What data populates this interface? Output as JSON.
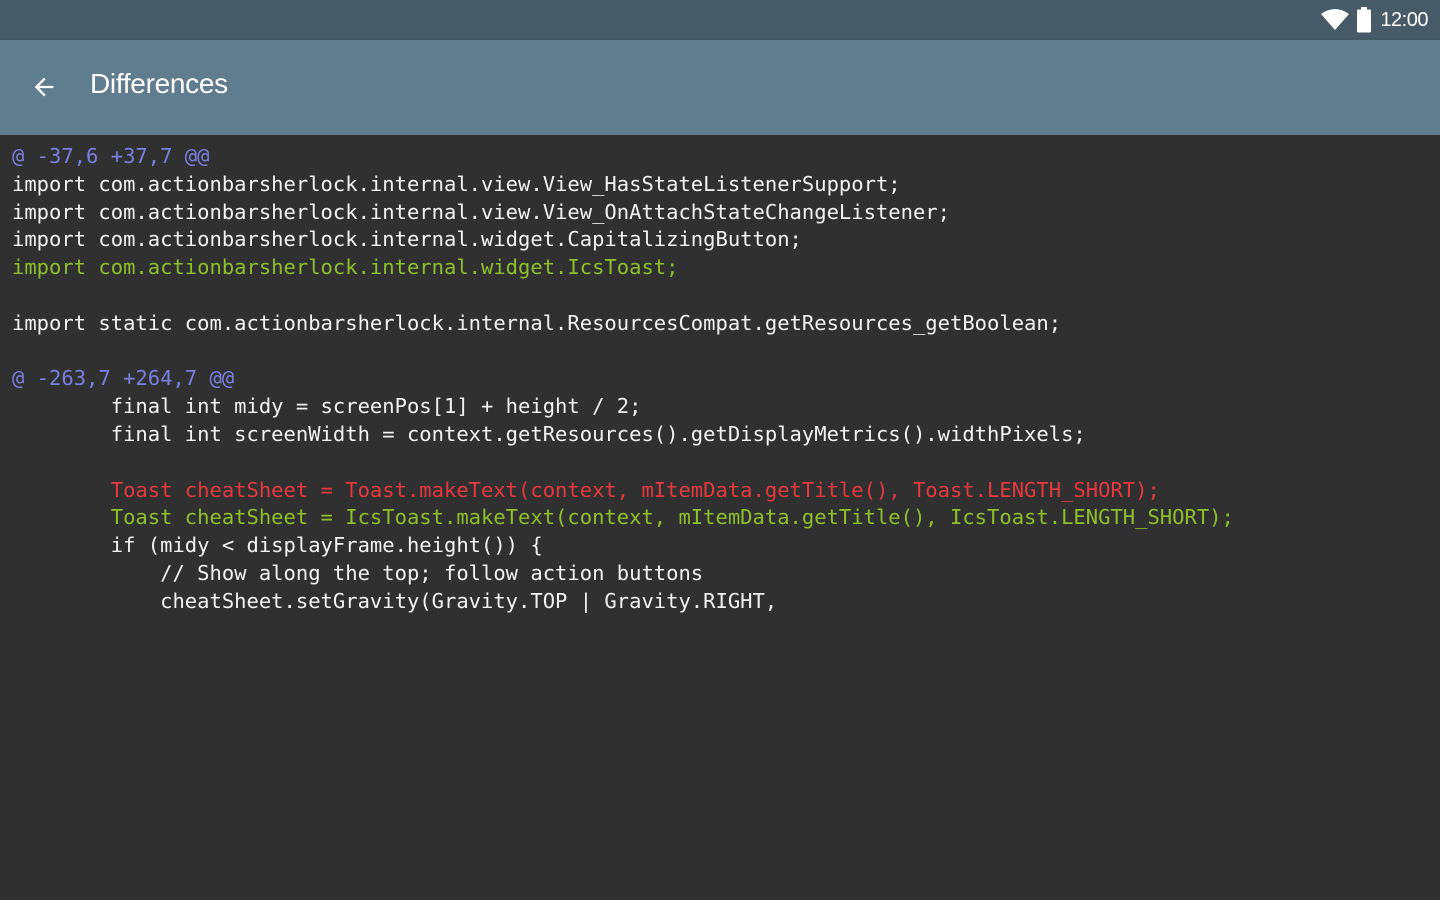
{
  "status_bar": {
    "time": "12:00",
    "icons": [
      "wifi-icon",
      "battery-icon"
    ]
  },
  "app_bar": {
    "back_icon": "arrow-back-icon",
    "title": "Differences"
  },
  "colors": {
    "status_bar": "#465a67",
    "app_bar": "#5f7d8e",
    "background": "#303030",
    "hunk_header": "#7b7fe0",
    "context": "#f2f2f2",
    "added": "#8fbf2a",
    "removed": "#e5393f"
  },
  "diff": {
    "lines": [
      {
        "type": "hunk",
        "text": "@ -37,6 +37,7 @@"
      },
      {
        "type": "ctx",
        "text": "import com.actionbarsherlock.internal.view.View_HasStateListenerSupport;"
      },
      {
        "type": "ctx",
        "text": "import com.actionbarsherlock.internal.view.View_OnAttachStateChangeListener;"
      },
      {
        "type": "ctx",
        "text": "import com.actionbarsherlock.internal.widget.CapitalizingButton;"
      },
      {
        "type": "add",
        "text": "import com.actionbarsherlock.internal.widget.IcsToast;"
      },
      {
        "type": "ctx",
        "text": ""
      },
      {
        "type": "ctx",
        "text": "import static com.actionbarsherlock.internal.ResourcesCompat.getResources_getBoolean;"
      },
      {
        "type": "ctx",
        "text": ""
      },
      {
        "type": "hunk",
        "text": "@ -263,7 +264,7 @@"
      },
      {
        "type": "ctx",
        "text": "        final int midy = screenPos[1] + height / 2;"
      },
      {
        "type": "ctx",
        "text": "        final int screenWidth = context.getResources().getDisplayMetrics().widthPixels;"
      },
      {
        "type": "ctx",
        "text": ""
      },
      {
        "type": "del",
        "text": "        Toast cheatSheet = Toast.makeText(context, mItemData.getTitle(), Toast.LENGTH_SHORT);"
      },
      {
        "type": "add",
        "text": "        Toast cheatSheet = IcsToast.makeText(context, mItemData.getTitle(), IcsToast.LENGTH_SHORT);"
      },
      {
        "type": "ctx",
        "text": "        if (midy < displayFrame.height()) {"
      },
      {
        "type": "ctx",
        "text": "            // Show along the top; follow action buttons"
      },
      {
        "type": "ctx",
        "text": "            cheatSheet.setGravity(Gravity.TOP | Gravity.RIGHT,"
      }
    ]
  }
}
